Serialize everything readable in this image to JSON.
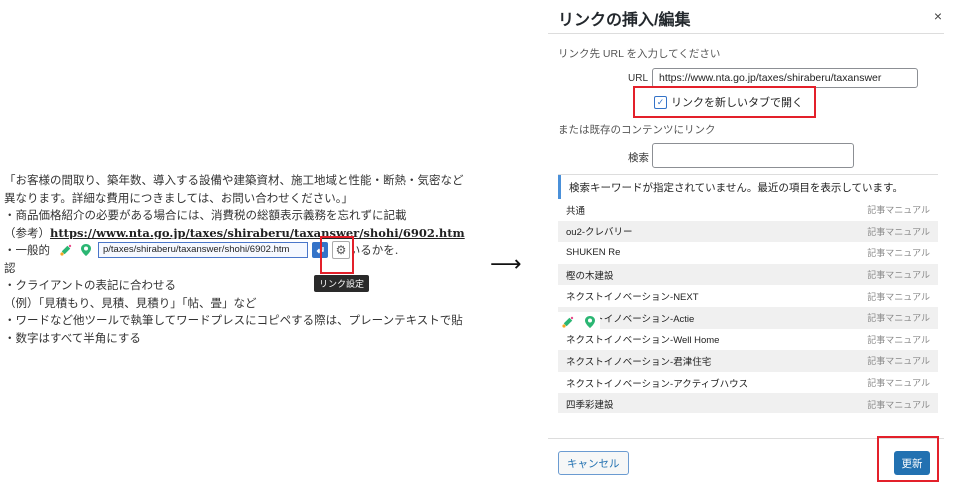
{
  "editor": {
    "lines": [
      "「お客様の間取り、築年数、導入する設備や建築資材、施工地域と性能・断熱・気密など",
      "異なります。詳細な費用につきましては、お問い合わせください。」",
      "・商品価格紹介の必要がある場合には、消費税の総額表示義務を忘れずに記載",
      "・一般的",
      "認",
      "・クライアントの表記に合わせる",
      "（例）「見積もり、見積、見積り」「帖、畳」など",
      "・ワードなど他ツールで執筆してワードプレスにコピペする際は、プレーンテキストで貼",
      "・数字はすべて半角にする"
    ],
    "ref_prefix": "（参考）",
    "ref_link": "https://www.nta.go.jp/taxes/shiraberu/taxanswer/shohi/6902.htm",
    "hidden_tail": "と合致しているかを.",
    "toolbar_url": "p/taxes/shiraberu/taxanswer/shohi/6902.htm",
    "tooltip": "リンク設定"
  },
  "arrow": "⟶",
  "dialog": {
    "title": "リンクの挿入/編集",
    "close": "×",
    "url_section": "リンク先 URL を入力してください",
    "url_label": "URL",
    "url_value": "https://www.nta.go.jp/taxes/shiraberu/taxanswer",
    "new_tab_label": "リンクを新しいタブで開く",
    "new_tab_checked": "✓",
    "existing_section": "または既存のコンテンツにリンク",
    "search_label": "検索",
    "results_header": "検索キーワードが指定されていません。最近の項目を表示しています。",
    "results": [
      {
        "title": "共通",
        "type": "記事マニュアル"
      },
      {
        "title": "ou2-クレバリー",
        "type": "記事マニュアル"
      },
      {
        "title": "SHUKEN Re",
        "type": "記事マニュアル"
      },
      {
        "title": "樫の木建設",
        "type": "記事マニュアル"
      },
      {
        "title": "ネクストイノベーション-NEXT",
        "type": "記事マニュアル"
      },
      {
        "title": "ネクストイノベーション-Actie",
        "type": "記事マニュアル"
      },
      {
        "title": "ネクストイノベーション-Well Home",
        "type": "記事マニュアル"
      },
      {
        "title": "ネクストイノベーション-君津住宅",
        "type": "記事マニュアル"
      },
      {
        "title": "ネクストイノベーション-アクティブハウス",
        "type": "記事マニュアル"
      },
      {
        "title": "四季彩建設",
        "type": "記事マニュアル"
      }
    ],
    "cancel": "キャンセル",
    "update": "更新"
  }
}
